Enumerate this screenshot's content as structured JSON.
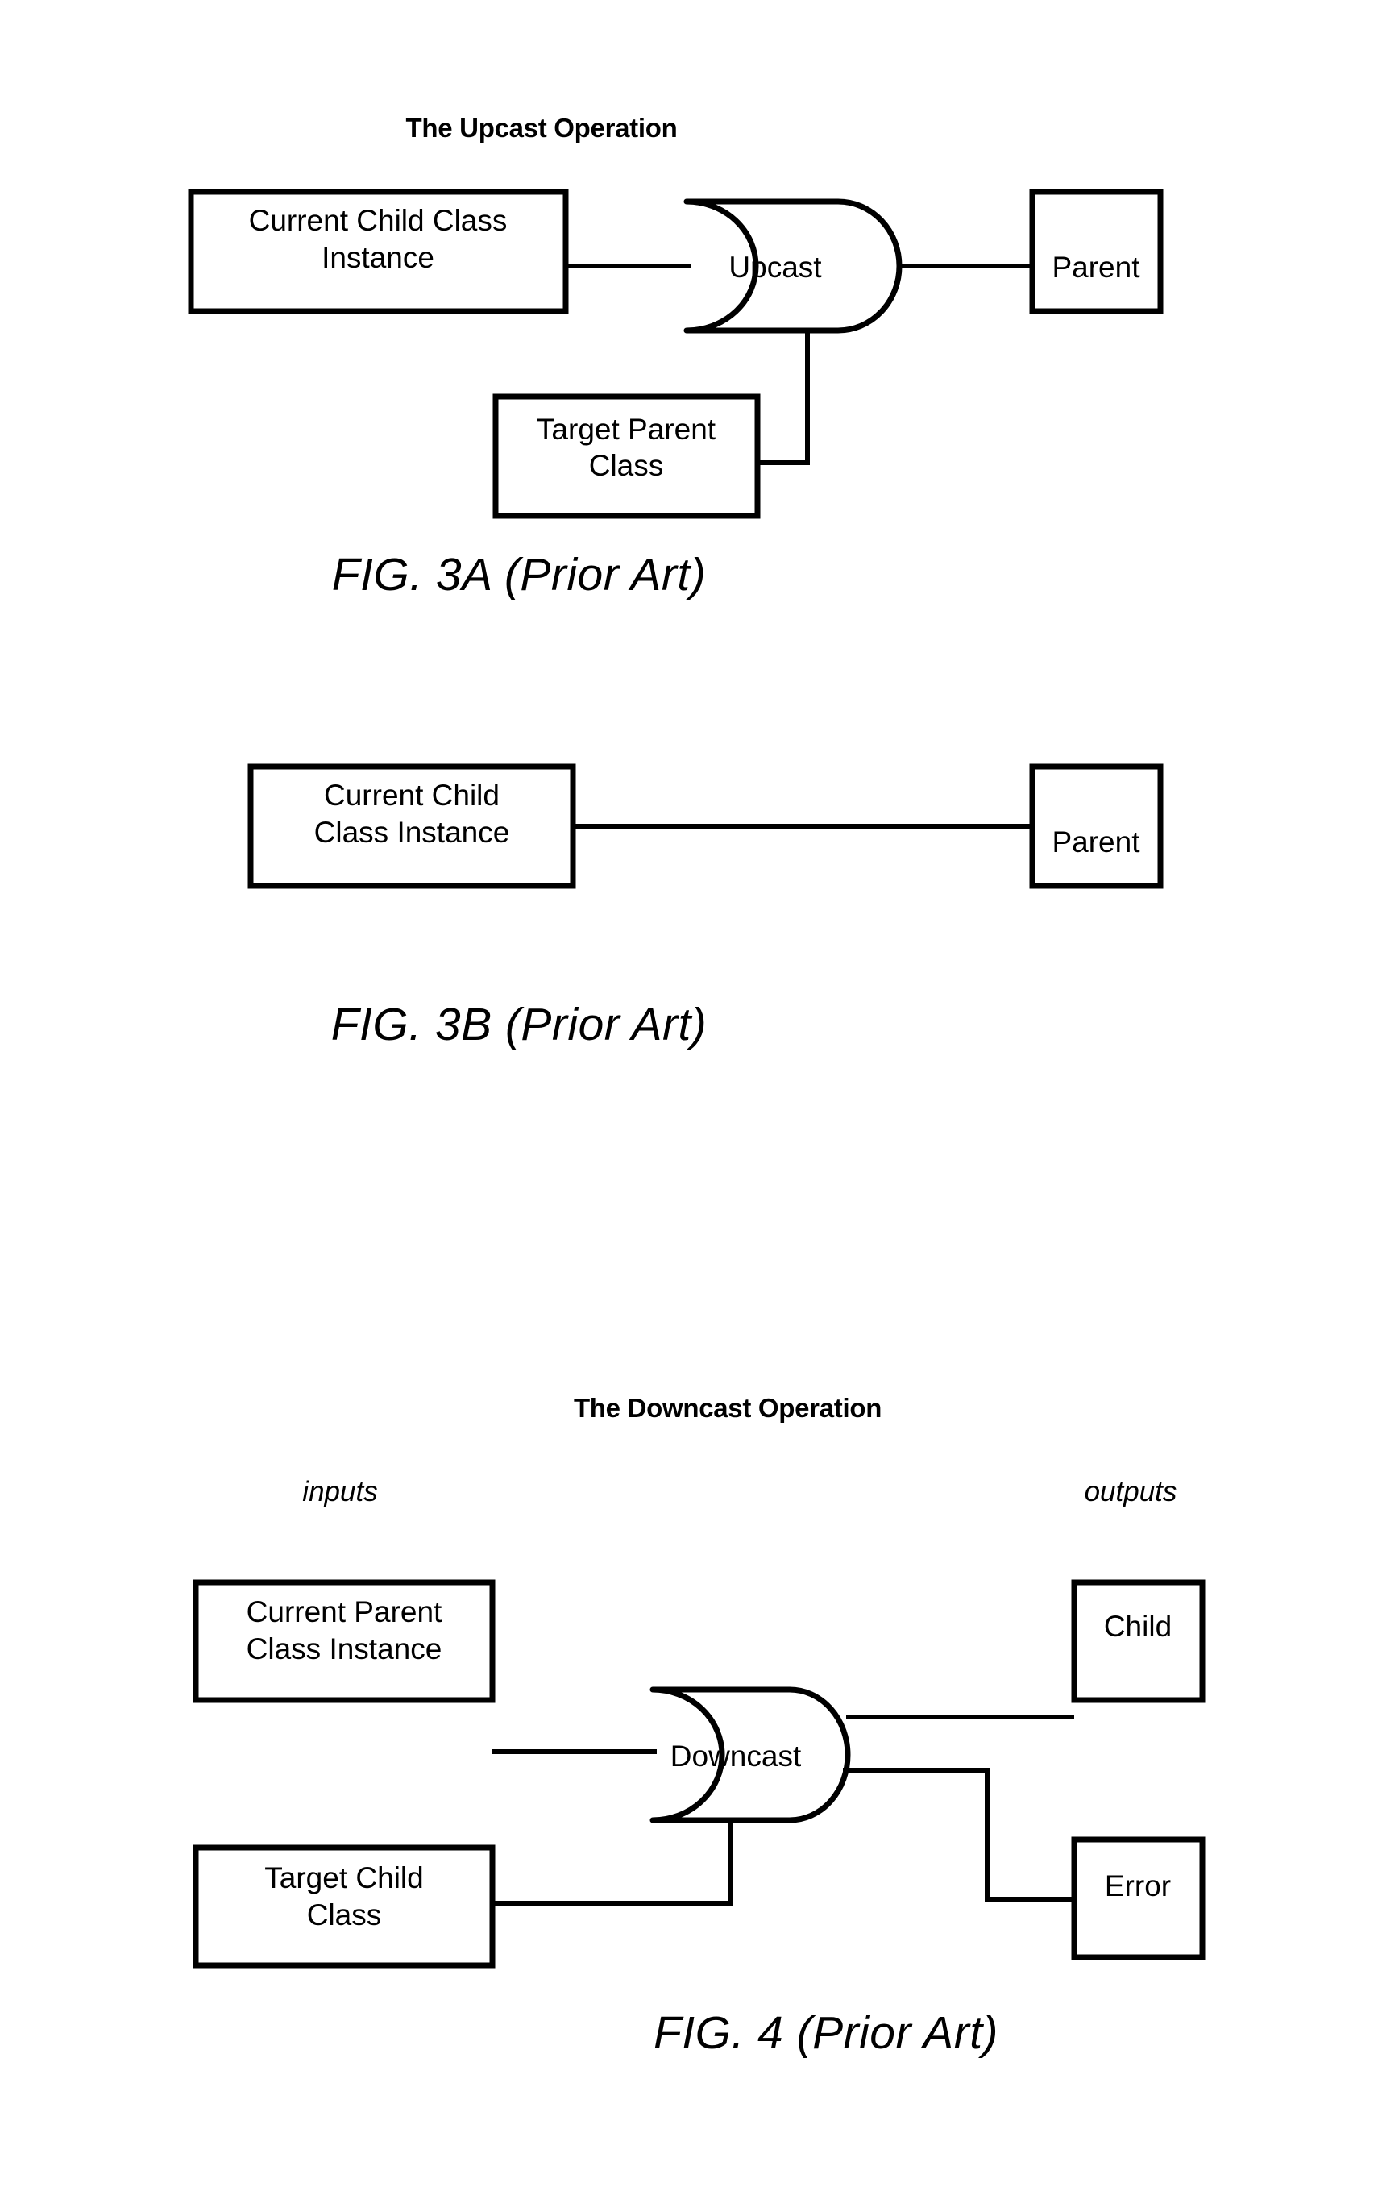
{
  "document": {
    "kind": "patent-figure-sheet",
    "page_background": "#ffffff",
    "ink_color": "#000000"
  },
  "figures": [
    {
      "id": "fig-3a",
      "title": "The Upcast Operation",
      "caption": "FIG. 3A (Prior Art)",
      "nodes": [
        {
          "id": "current-child-class-instance",
          "shape": "rect",
          "lines": [
            "Current Child Class",
            "Instance"
          ]
        },
        {
          "id": "upcast-gate",
          "shape": "and-gate",
          "lines": [
            "Upcast"
          ]
        },
        {
          "id": "parent",
          "shape": "rect",
          "lines": [
            "Parent"
          ]
        },
        {
          "id": "target-parent-class",
          "shape": "rect",
          "lines": [
            "Target Parent",
            "Class"
          ]
        }
      ],
      "edges": [
        {
          "from": "current-child-class-instance",
          "to": "upcast-gate"
        },
        {
          "from": "upcast-gate",
          "to": "parent"
        },
        {
          "from": "target-parent-class",
          "to": "upcast-gate"
        }
      ]
    },
    {
      "id": "fig-3b",
      "title": "",
      "caption": "FIG. 3B (Prior Art)",
      "nodes": [
        {
          "id": "current-child-class-instance",
          "shape": "rect",
          "lines": [
            "Current Child",
            "Class Instance"
          ]
        },
        {
          "id": "parent",
          "shape": "rect",
          "lines": [
            "Parent"
          ]
        }
      ],
      "edges": [
        {
          "from": "current-child-class-instance",
          "to": "parent"
        }
      ]
    },
    {
      "id": "fig-4",
      "title": "The Downcast Operation",
      "caption": "FIG. 4 (Prior Art)",
      "column_labels": {
        "left": "inputs",
        "right": "outputs"
      },
      "nodes": [
        {
          "id": "current-parent-class-instance",
          "shape": "rect",
          "lines": [
            "Current Parent",
            "Class Instance"
          ]
        },
        {
          "id": "target-child-class",
          "shape": "rect",
          "lines": [
            "Target Child",
            "Class"
          ]
        },
        {
          "id": "downcast-gate",
          "shape": "and-gate",
          "lines": [
            "Downcast"
          ]
        },
        {
          "id": "child",
          "shape": "rect",
          "lines": [
            "Child"
          ]
        },
        {
          "id": "error",
          "shape": "rect",
          "lines": [
            "Error"
          ]
        }
      ],
      "edges": [
        {
          "from": "current-parent-class-instance",
          "to": "downcast-gate"
        },
        {
          "from": "target-child-class",
          "to": "downcast-gate"
        },
        {
          "from": "downcast-gate",
          "to": "child"
        },
        {
          "from": "downcast-gate",
          "to": "error"
        }
      ]
    }
  ],
  "text": {
    "fig3a": {
      "title": "The Upcast Operation",
      "caption": "FIG. 3A (Prior Art)",
      "child_box_line1": "Current Child Class",
      "child_box_line2": "Instance",
      "gate_label": "Upcast",
      "parent_box": "Parent",
      "target_box_line1": "Target Parent",
      "target_box_line2": "Class"
    },
    "fig3b": {
      "caption": "FIG. 3B (Prior Art)",
      "child_box_line1": "Current Child",
      "child_box_line2": "Class Instance",
      "parent_box": "Parent"
    },
    "fig4": {
      "title": "The Downcast Operation",
      "caption": "FIG. 4 (Prior Art)",
      "inputs_label": "inputs",
      "outputs_label": "outputs",
      "parent_box_line1": "Current Parent",
      "parent_box_line2": "Class Instance",
      "target_box_line1": "Target Child",
      "target_box_line2": "Class",
      "gate_label": "Downcast",
      "child_box": "Child",
      "error_box": "Error"
    }
  }
}
